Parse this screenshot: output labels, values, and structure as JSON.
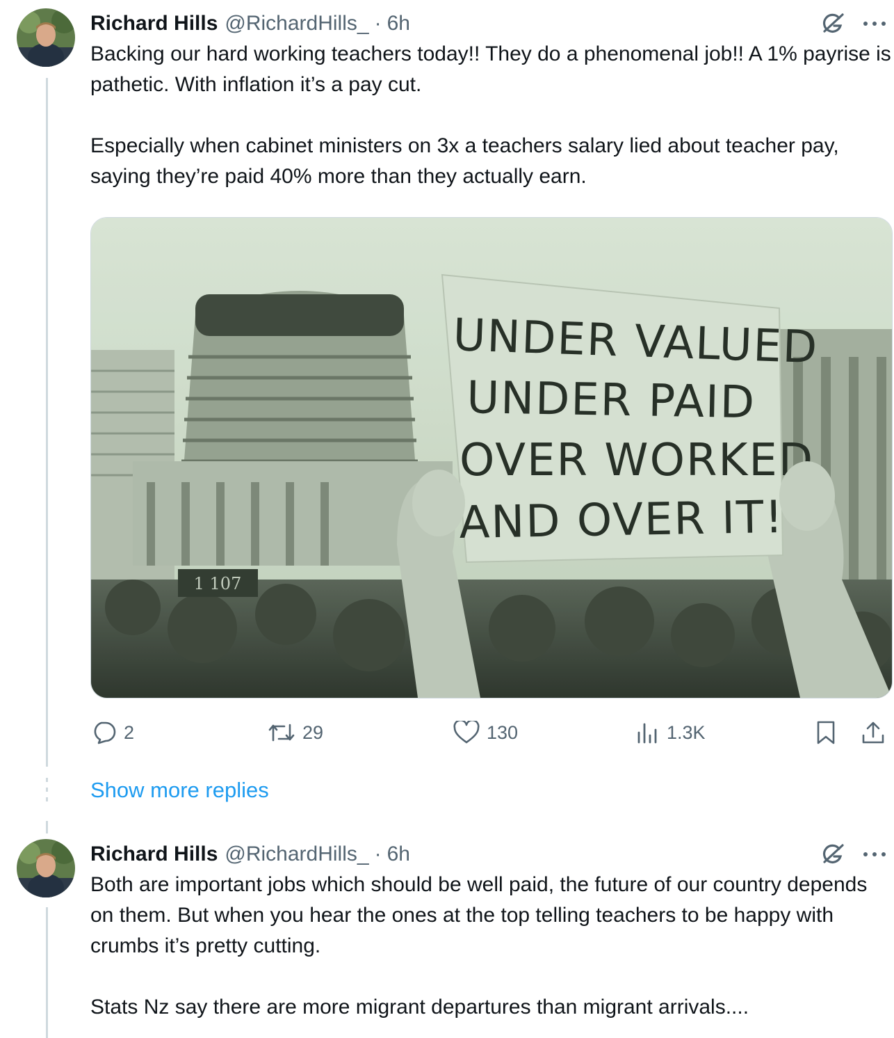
{
  "tweets": [
    {
      "author_name": "Richard Hills",
      "author_handle": "@RichardHills_",
      "separator": "·",
      "time": "6h",
      "text": "Backing our hard working teachers today!! They do a phenomenal job!! A 1% payrise is pathetic. With inflation it’s a pay cut.\n\nEspecially when cabinet ministers on 3x a teachers salary lied about teacher pay, saying they’re paid 40% more than they actually earn.",
      "media_sign_lines": [
        "UNDER  VALUED",
        "UNDER  PAID",
        "OVER  WORKED",
        "AND  OVER  IT!"
      ],
      "media_banner": "1 107",
      "actions": {
        "replies": "2",
        "reposts": "29",
        "likes": "130",
        "views": "1.3K"
      }
    },
    {
      "author_name": "Richard Hills",
      "author_handle": "@RichardHills_",
      "separator": "·",
      "time": "6h",
      "text": "Both are important jobs which should be well paid, the future of our country depends on them. But when you hear the ones at the top telling teachers to be happy with crumbs it’s pretty cutting.\n\nStats Nz say there are more migrant departures than migrant arrivals...."
    }
  ],
  "show_more_replies": "Show more replies",
  "icons": {
    "grok": "grok-icon",
    "more": "more-icon",
    "reply": "reply-icon",
    "repost": "repost-icon",
    "like": "like-icon",
    "views": "views-icon",
    "bookmark": "bookmark-icon",
    "share": "share-icon"
  },
  "colors": {
    "text": "#0f1419",
    "muted": "#536471",
    "link": "#1d9bf0",
    "thread_line": "#cfd9de"
  }
}
